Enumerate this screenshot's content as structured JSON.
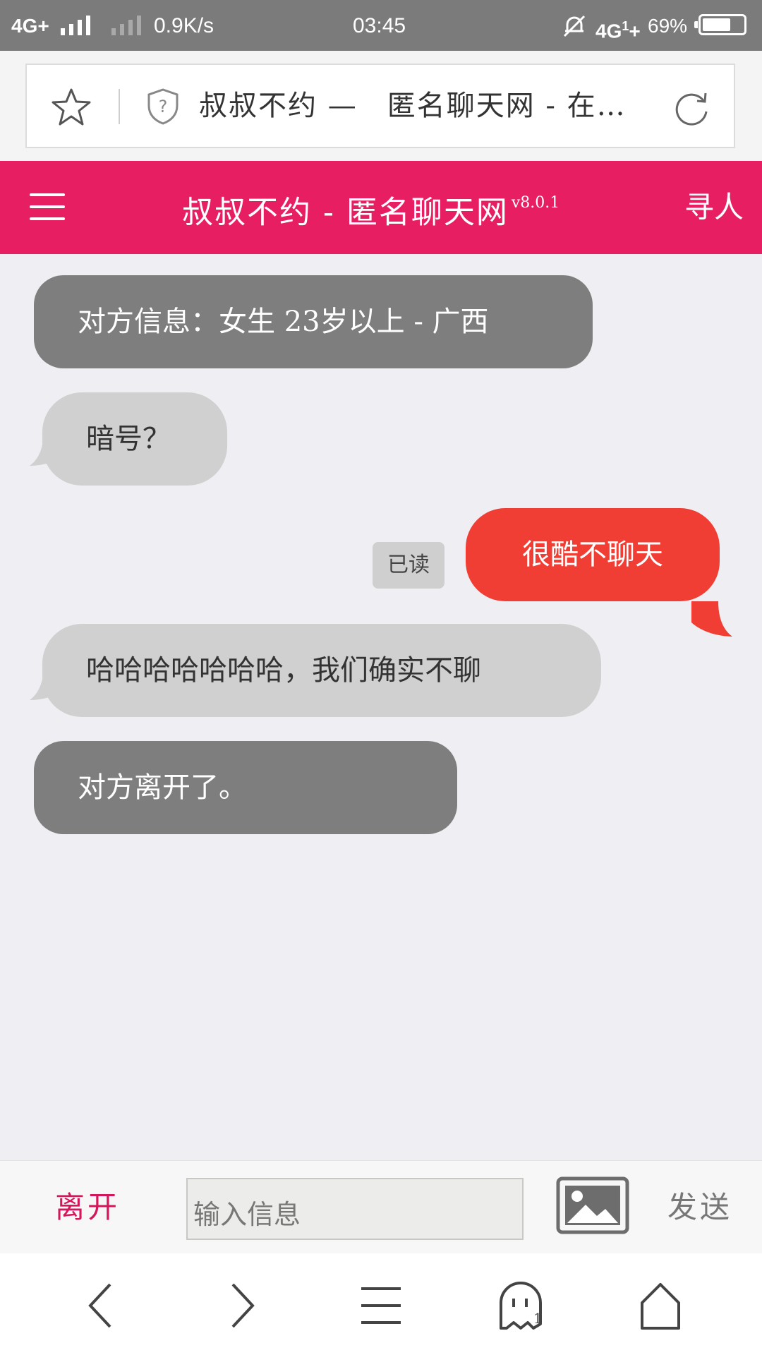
{
  "status_bar": {
    "network_left": "4G+",
    "speed": "0.9K/s",
    "time": "03:45",
    "network_right": "4G",
    "network_right_plus": "+",
    "battery": "69%",
    "battery_level": 0.69
  },
  "browser": {
    "page_title": "叔叔不约 —　匿名聊天网 - 在…",
    "icons": [
      "star-icon",
      "shield-question-icon",
      "refresh-icon"
    ]
  },
  "app_header": {
    "title": "叔叔不约 - 匿名聊天网",
    "version": "v8.0.1",
    "find_label": "寻人",
    "color": "#e81e63"
  },
  "messages": [
    {
      "type": "system",
      "text": "对方信息：女生 23岁以上 - 广西"
    },
    {
      "type": "incoming",
      "text": "暗号？"
    },
    {
      "type": "outgoing",
      "text": "很酷不聊天",
      "status": "已读"
    },
    {
      "type": "incoming",
      "text": "哈哈哈哈哈哈哈，我们确实不聊"
    },
    {
      "type": "system",
      "text": "对方离开了。"
    }
  ],
  "input_bar": {
    "leave_label": "离开",
    "placeholder": "输入信息",
    "value": "",
    "send_label": "发送",
    "leave_color": "#d4165b"
  },
  "nav": {
    "tab_count": "1",
    "icons": [
      "back-icon",
      "forward-icon",
      "menu-icon",
      "tabs-icon",
      "home-icon"
    ]
  },
  "colors": {
    "outgoing_bubble": "#f03e34",
    "incoming_bubble": "#d0d0d0",
    "system_bubble": "#7e7e7e",
    "background": "#efeff3"
  }
}
